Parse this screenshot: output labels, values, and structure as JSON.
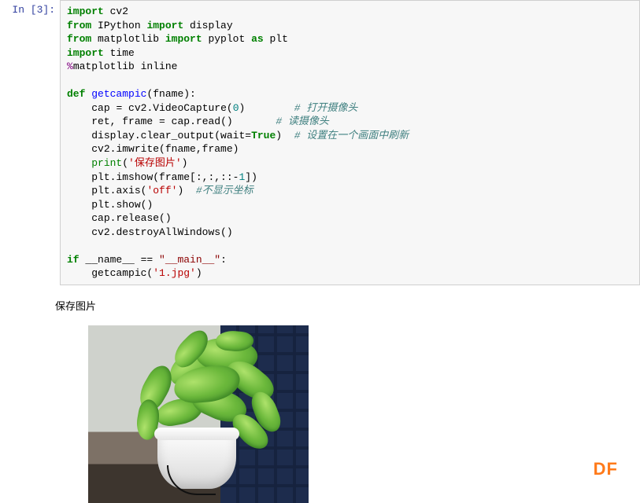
{
  "cell": {
    "prompt": "In  [3]:",
    "code": {
      "l1": {
        "kw1": "import",
        "sp": " ",
        "m": "cv2"
      },
      "l2": {
        "kw1": "from",
        "m1": " IPython ",
        "kw2": "import",
        "m2": " display"
      },
      "l3": {
        "kw1": "from",
        "m1": " matplotlib ",
        "kw2": "import",
        "m2": " pyplot ",
        "kw3": "as",
        "m3": " plt"
      },
      "l4": {
        "kw1": "import",
        "m": " time"
      },
      "l5": {
        "mag": "%",
        "m": "matplotlib inline"
      },
      "l7": {
        "kw1": "def",
        "sp": " ",
        "fn": "getcampic",
        "rest": "(fname):"
      },
      "l8": {
        "ind": "    ",
        "a": "cap ",
        "op": "=",
        "b": " cv2",
        "dot": ".",
        "c": "VideoCapture(",
        "n": "0",
        "d": ")        ",
        "cm": "# 打开摄像头"
      },
      "l9": {
        "ind": "    ",
        "a": "ret, frame ",
        "op": "=",
        "b": " cap",
        "dot": ".",
        "c": "read()       ",
        "cm": "# 读摄像头"
      },
      "l10": {
        "ind": "    ",
        "a": "display",
        "dot": ".",
        "b": "clear_output(wait",
        "op": "=",
        "tr": "True",
        "c": ")  ",
        "cm": "# 设置在一个画面中刷新"
      },
      "l11": {
        "ind": "    ",
        "a": "cv2",
        "dot": ".",
        "b": "imwrite(fname,frame)"
      },
      "l12": {
        "ind": "    ",
        "p": "print",
        "a": "(",
        "s": "'保存图片'",
        "b": ")"
      },
      "l13": {
        "ind": "    ",
        "a": "plt",
        "dot": ".",
        "b": "imshow(frame[:,:,::",
        "n": "-",
        "n2": "1",
        "c": "])"
      },
      "l14": {
        "ind": "    ",
        "a": "plt",
        "dot": ".",
        "b": "axis(",
        "s": "'off'",
        "c": ")  ",
        "cm": "#不显示坐标"
      },
      "l15": {
        "ind": "    ",
        "a": "plt",
        "dot": ".",
        "b": "show()"
      },
      "l16": {
        "ind": "    ",
        "a": "cap",
        "dot": ".",
        "b": "release()"
      },
      "l17": {
        "ind": "    ",
        "a": "cv2",
        "dot": ".",
        "b": "destroyAllWindows()"
      },
      "l19": {
        "kw": "if",
        "a": " __name__ ",
        "op": "==",
        "b": " ",
        "s": "\"__main__\"",
        "c": ":"
      },
      "l20": {
        "ind": "    ",
        "a": "getcampic(",
        "s": "'1.jpg'",
        "b": ")"
      }
    }
  },
  "output": {
    "stdout": "保存图片"
  },
  "watermark": "DF"
}
